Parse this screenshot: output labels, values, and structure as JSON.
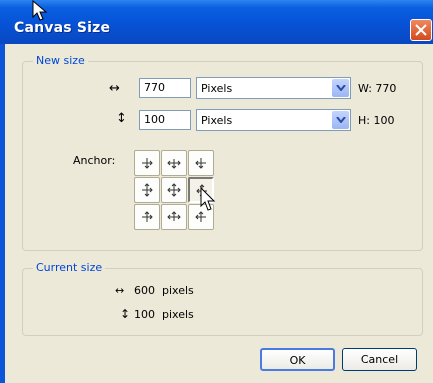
{
  "title": "Canvas Size",
  "new_size": {
    "legend": "New size",
    "width": {
      "icon": "horizontal-resize-icon",
      "arrow": "↔",
      "value": "770",
      "unit": "Pixels",
      "readout": "W: 770"
    },
    "height": {
      "icon": "vertical-resize-icon",
      "arrow": "↕",
      "value": "100",
      "unit": "Pixels",
      "readout": "H: 100"
    },
    "anchor_label": "Anchor:",
    "anchor_selected": "middle-right"
  },
  "current_size": {
    "legend": "Current size",
    "width_text": "600  pixels",
    "height_text": "100  pixels",
    "arrow_w": "↔",
    "arrow_h": "↕"
  },
  "buttons": {
    "ok": "OK",
    "cancel": "Cancel"
  },
  "colors": {
    "title_bar": "#0752d6",
    "legend_text": "#0046d5",
    "dialog_bg": "#ece9d8"
  }
}
